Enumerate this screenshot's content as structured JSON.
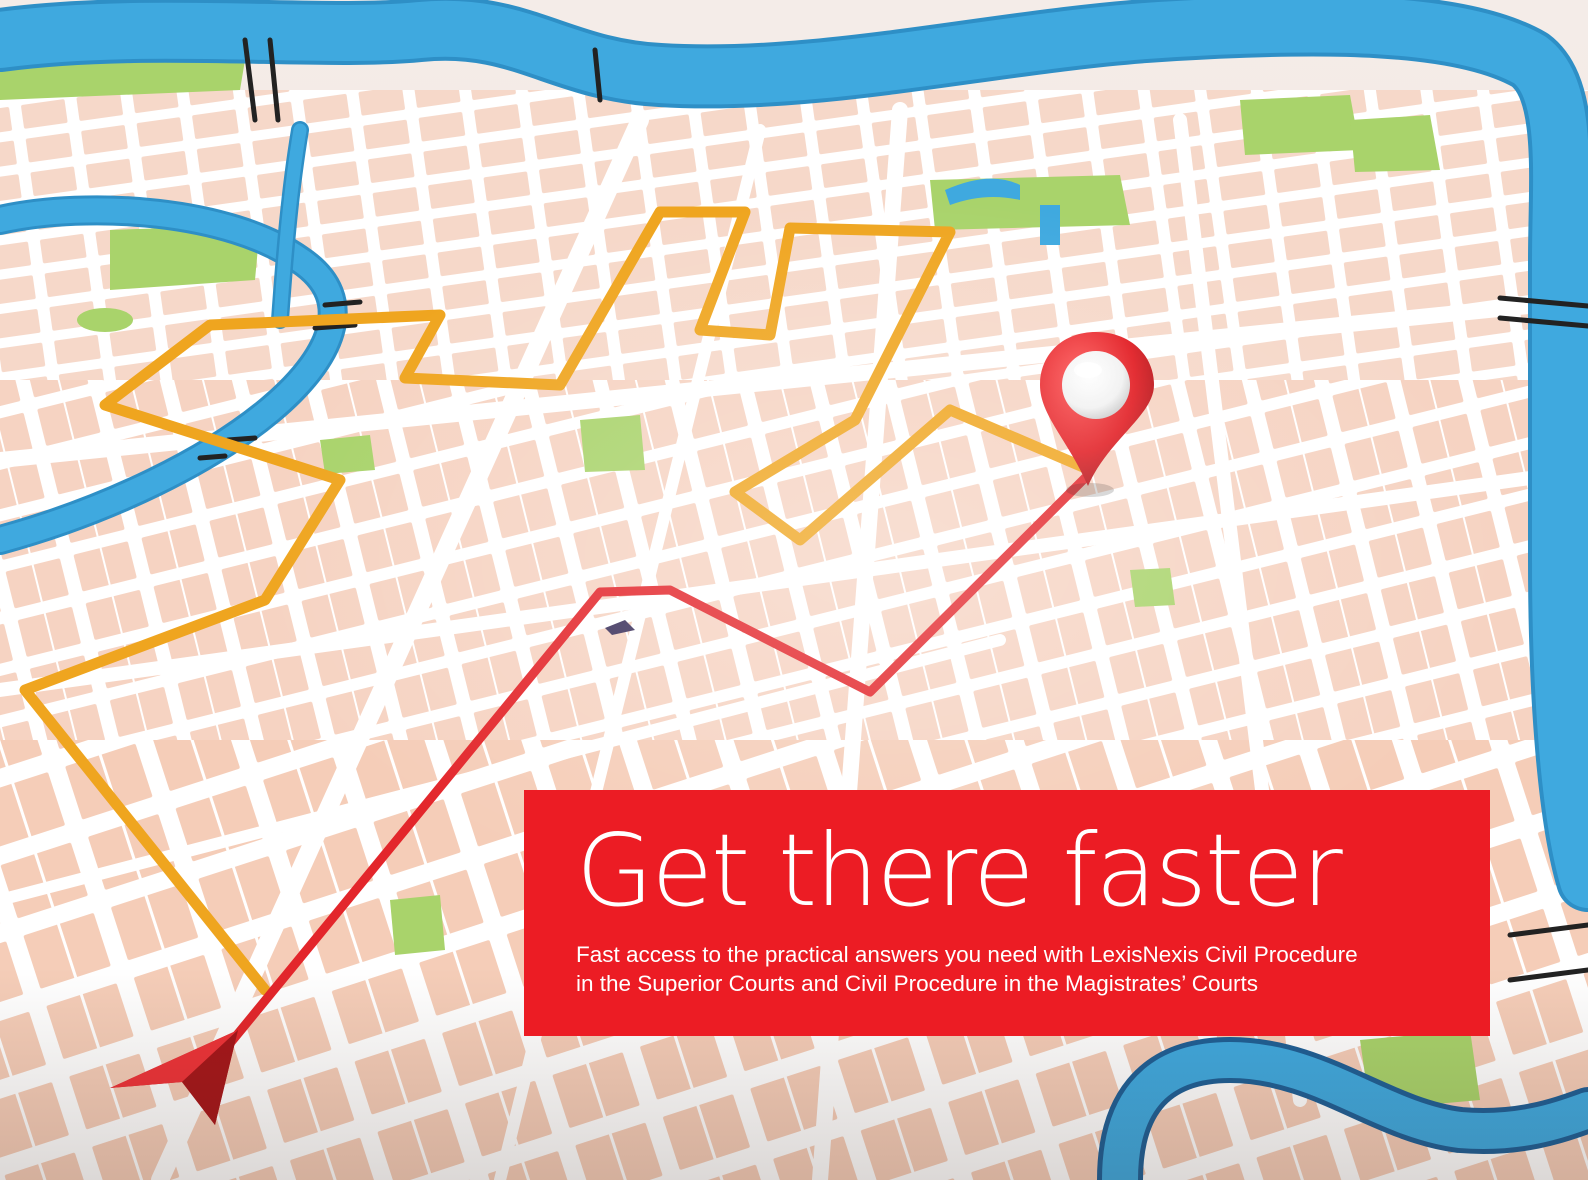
{
  "banner": {
    "title": "Get there faster",
    "subtitle_line1": "Fast access to the practical answers you need with LexisNexis Civil Procedure",
    "subtitle_line2": "in the Superior Courts and Civil Procedure in the Magistrates’ Courts"
  },
  "colors": {
    "banner_red": "#ec1c24",
    "route_red": "#e3262b",
    "route_orange": "#efa51f",
    "water_blue": "#3fa9df",
    "park_green": "#a9d36b",
    "block_pink": "#f5cdb8",
    "street_white": "#ffffff"
  },
  "icons": {
    "destination": "map-pin-icon",
    "origin": "arrow-head-icon"
  }
}
